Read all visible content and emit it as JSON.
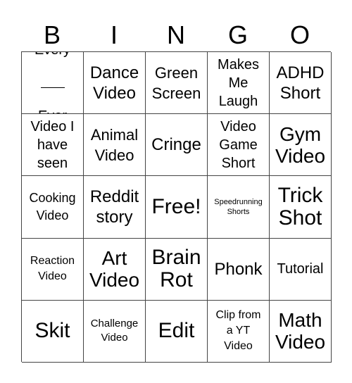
{
  "header": [
    "B",
    "I",
    "N",
    "G",
    "O"
  ],
  "cells": [
    [
      "Every\n\nEver",
      "Dance\nVideo",
      "Green\nScreen",
      "Makes\nMe\nLaugh",
      "ADHD\nShort"
    ],
    [
      "Video I\nhave\nseen",
      "Animal\nVideo",
      "Cringe",
      "Video\nGame\nShort",
      "Gym\nVideo"
    ],
    [
      "Cooking\nVideo",
      "Reddit\nstory",
      "Free!",
      "Speedrunning\nShorts",
      "Trick\nShot"
    ],
    [
      "Reaction\nVideo",
      "Art\nVideo",
      "Brain\nRot",
      "Phonk",
      "Tutorial"
    ],
    [
      "Skit",
      "Challenge\nVideo",
      "Edit",
      "Clip from\na YT\nVideo",
      "Math\nVideo"
    ]
  ],
  "every_ever": {
    "top": "Every",
    "bottom": "Ever"
  }
}
